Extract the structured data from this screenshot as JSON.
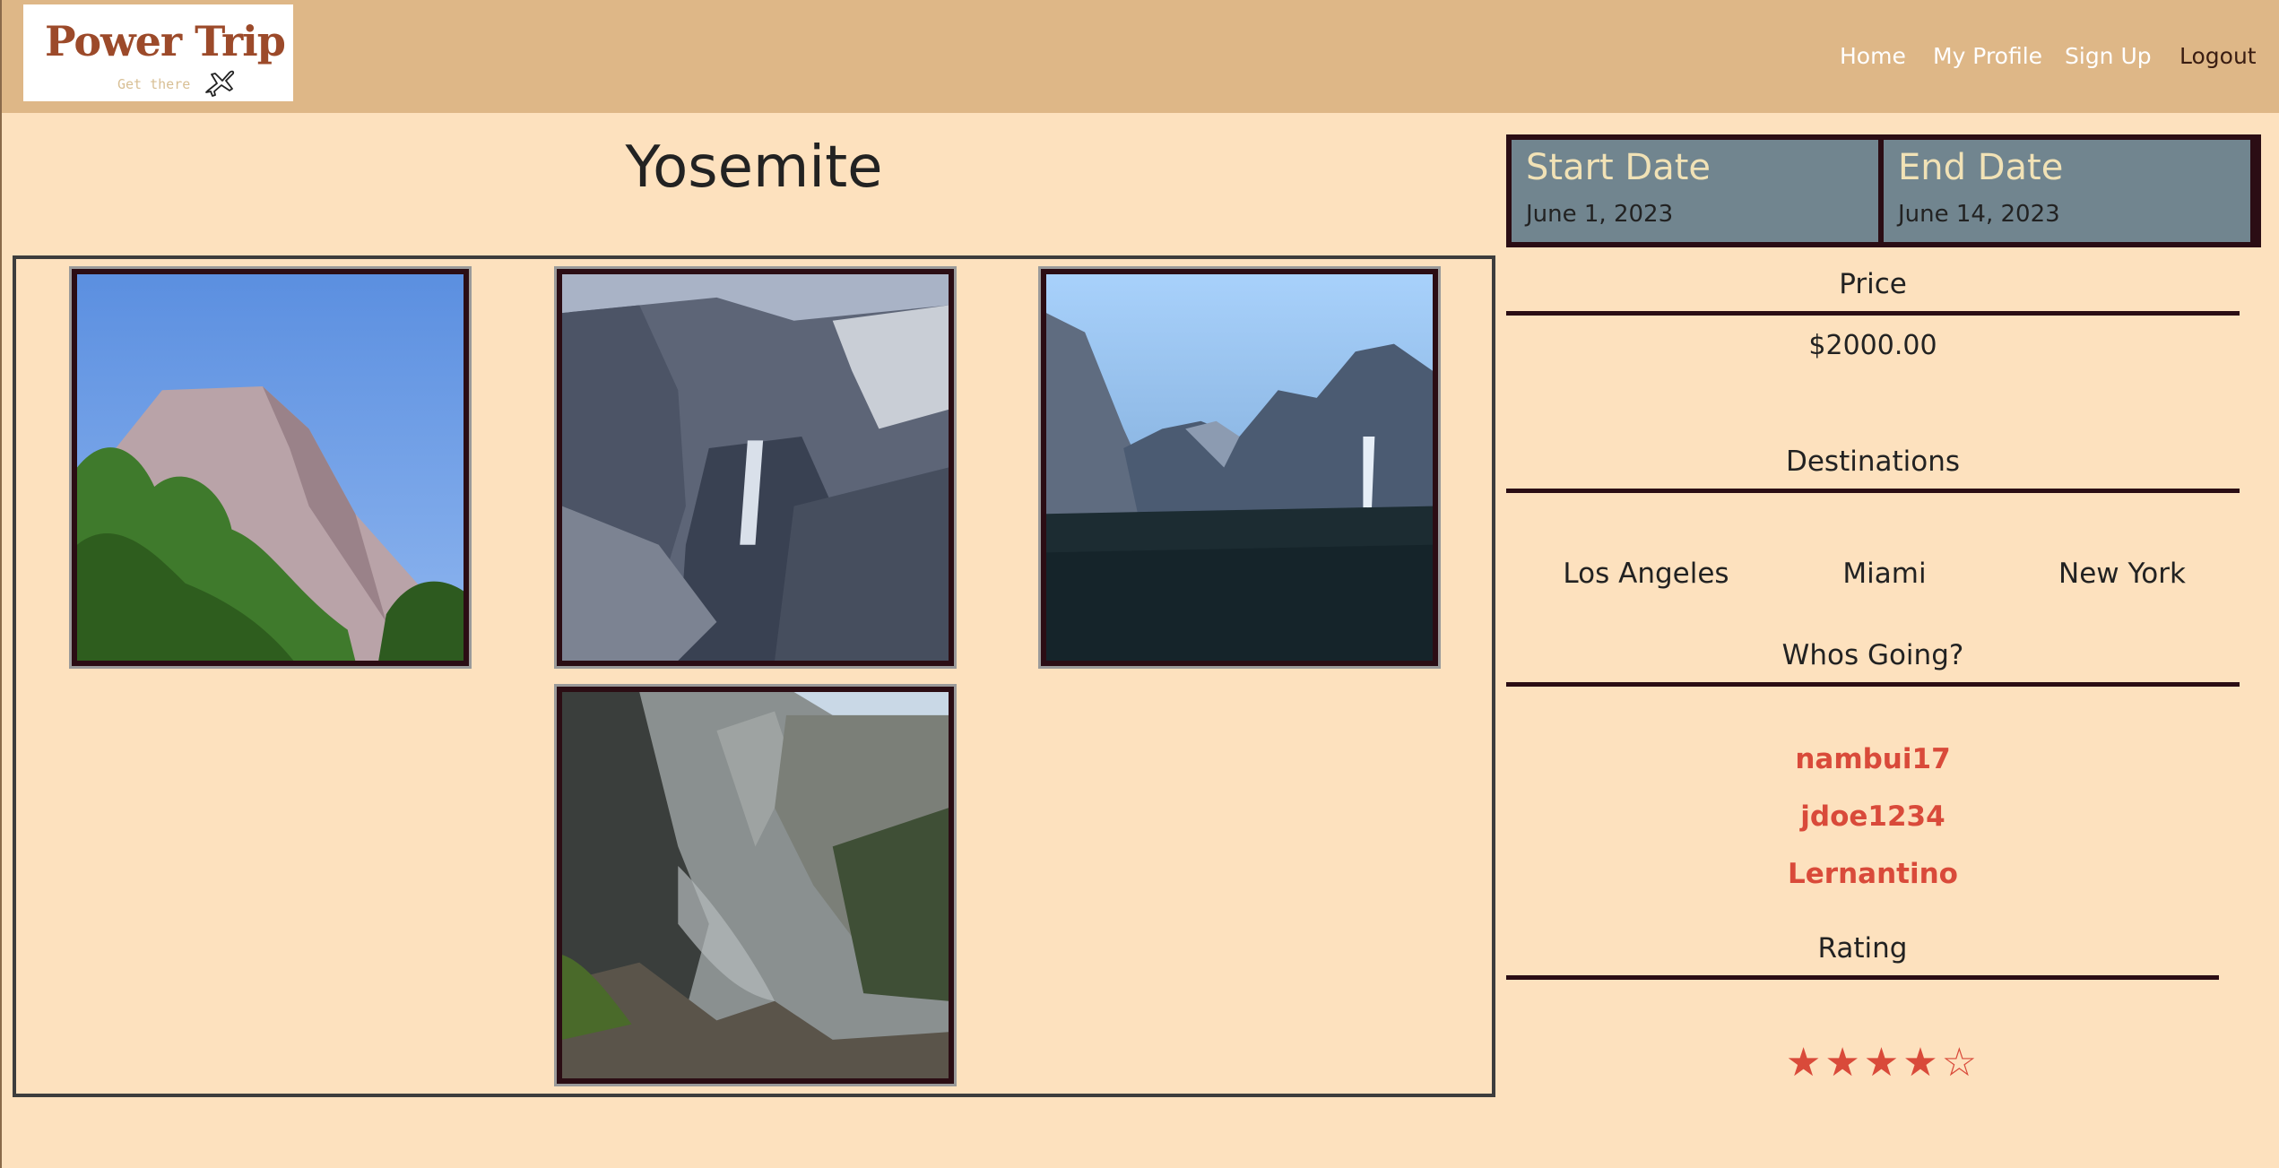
{
  "logo": {
    "title": "Power Trip",
    "tagline": "Get there"
  },
  "nav": {
    "home": "Home",
    "profile": "My Profile",
    "signup": "Sign Up",
    "logout": "Logout"
  },
  "trip": {
    "title": "Yosemite",
    "start_label": "Start Date",
    "start_value": "June 1, 2023",
    "end_label": "End Date",
    "end_value": "June 14, 2023",
    "price_label": "Price",
    "price_value": "$2000.00",
    "destinations_label": "Destinations",
    "destinations": [
      "Los Angeles",
      "Miami",
      "New York"
    ],
    "going_label": "Whos Going?",
    "members": [
      "nambui17",
      "jdoe1234",
      "Lernantino"
    ],
    "rating_label": "Rating",
    "rating": 4,
    "rating_max": 5
  },
  "photos": [
    "el-capitan-photo",
    "waterfall-valley-photo",
    "tunnel-view-photo",
    "canyon-mist-photo"
  ],
  "colors": {
    "navbar": "#deb787",
    "background": "#fde1be",
    "accent": "#d94a3a",
    "date_panel": "#71858f",
    "frame": "#2b0d14"
  }
}
